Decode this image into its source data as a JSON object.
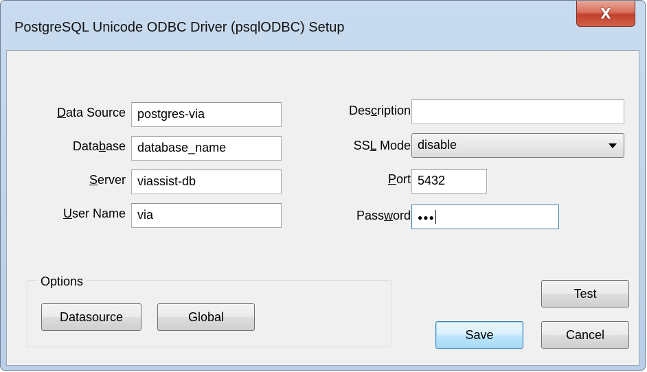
{
  "window": {
    "title": "PostgreSQL Unicode ODBC Driver (psqlODBC) Setup",
    "close_glyph": "X"
  },
  "form": {
    "data_source": {
      "label_u": "D",
      "label_rest": "ata Source",
      "value": "postgres-via"
    },
    "database": {
      "label_pre": "Data",
      "label_u": "b",
      "label_rest": "ase",
      "value": "database_name"
    },
    "server": {
      "label_u": "S",
      "label_rest": "erver",
      "value": "viassist-db"
    },
    "user_name": {
      "label_u": "U",
      "label_rest": "ser Name",
      "value": "via"
    },
    "description": {
      "label_pre": "Des",
      "label_u": "c",
      "label_rest": "ription",
      "value": ""
    },
    "ssl_mode": {
      "label_pre": "SS",
      "label_u": "L",
      "label_rest": " Mode",
      "value": "disable"
    },
    "port": {
      "label_u": "P",
      "label_rest": "ort",
      "value": "5432"
    },
    "password": {
      "label_pre": "Pass",
      "label_u": "w",
      "label_rest": "ord",
      "value": "●●●"
    }
  },
  "options": {
    "group_label": "Options",
    "datasource_button": "Datasource",
    "global_button": "Global"
  },
  "buttons": {
    "test": "Test",
    "save": "Save",
    "cancel": "Cancel"
  },
  "colors": {
    "client_bg": "#f0f0f0",
    "title_bg": "#c9dbef",
    "close_red": "#c0412b",
    "default_button_border": "#3c7fb1"
  }
}
